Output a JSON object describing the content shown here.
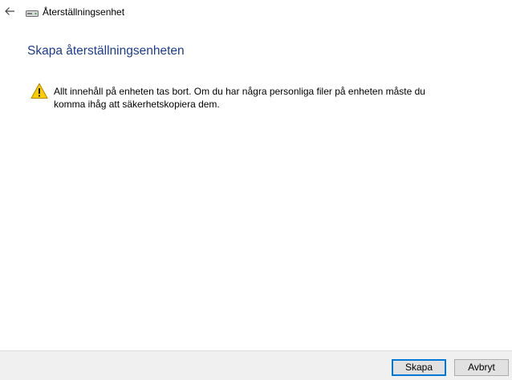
{
  "window": {
    "title": "Återställningsenhet",
    "icon": "drive-icon"
  },
  "page": {
    "heading": "Skapa återställningsenheten",
    "warning": {
      "icon": "warning-icon",
      "text": "Allt innehåll på enheten tas bort. Om du har några personliga filer på enheten måste du komma ihåg att säkerhetskopiera dem."
    }
  },
  "footer": {
    "create_label": "Skapa",
    "cancel_label": "Avbryt"
  },
  "colors": {
    "heading": "#1a3c8f",
    "primary_border": "#0078d7",
    "footer_bg": "#f0f0f0",
    "warning_fill": "#ffcc00"
  }
}
